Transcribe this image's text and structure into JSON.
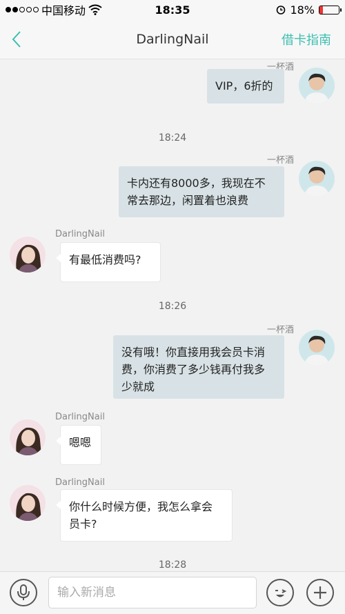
{
  "status_bar": {
    "carrier": "中国移动",
    "time": "18:35",
    "battery_text": "18%",
    "battery_level": 0.18
  },
  "nav": {
    "title": "DarlingNail",
    "action_label": "借卡指南",
    "accent_color": "#3cbfb0"
  },
  "messages": [
    {
      "sender": "一杯酒",
      "text": "VIP，6折的"
    },
    {
      "time": "18:24"
    },
    {
      "sender": "一杯酒",
      "text_lines": [
        "卡内还有8000多，我现在不",
        "常去那边，闲置着也浪费"
      ]
    },
    {
      "sender": "DarlingNail",
      "text": "有最低消费吗?"
    },
    {
      "time": "18:26"
    },
    {
      "sender": "一杯酒",
      "text_lines": [
        "没有哦！你直接用我会员卡消",
        "费，你消费了多少钱再付我多",
        "少就成"
      ]
    },
    {
      "sender": "DarlingNail",
      "text": "嗯嗯"
    },
    {
      "sender": "DarlingNail",
      "text_lines": [
        "你什么时候方便，我怎么拿会",
        "员卡?"
      ]
    },
    {
      "time": "18:28"
    }
  ],
  "input": {
    "placeholder": "输入新消息"
  },
  "colors": {
    "outgoing_bubble": "#d8e2e6",
    "incoming_bubble": "#ffffff",
    "background": "#f2f2f2"
  }
}
